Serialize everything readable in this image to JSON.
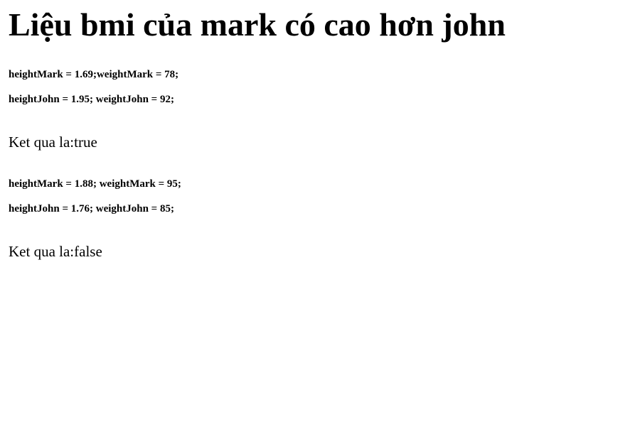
{
  "heading": "Liệu bmi của mark có cao hơn john",
  "tests": [
    {
      "mark_line": "heightMark = 1.69;weightMark = 78;",
      "john_line": "heightJohn = 1.95; weightJohn = 92;",
      "result": "Ket qua la:true"
    },
    {
      "mark_line": "heightMark = 1.88; weightMark = 95;",
      "john_line": "heightJohn = 1.76; weightJohn = 85;",
      "result": "Ket qua la:false"
    }
  ]
}
